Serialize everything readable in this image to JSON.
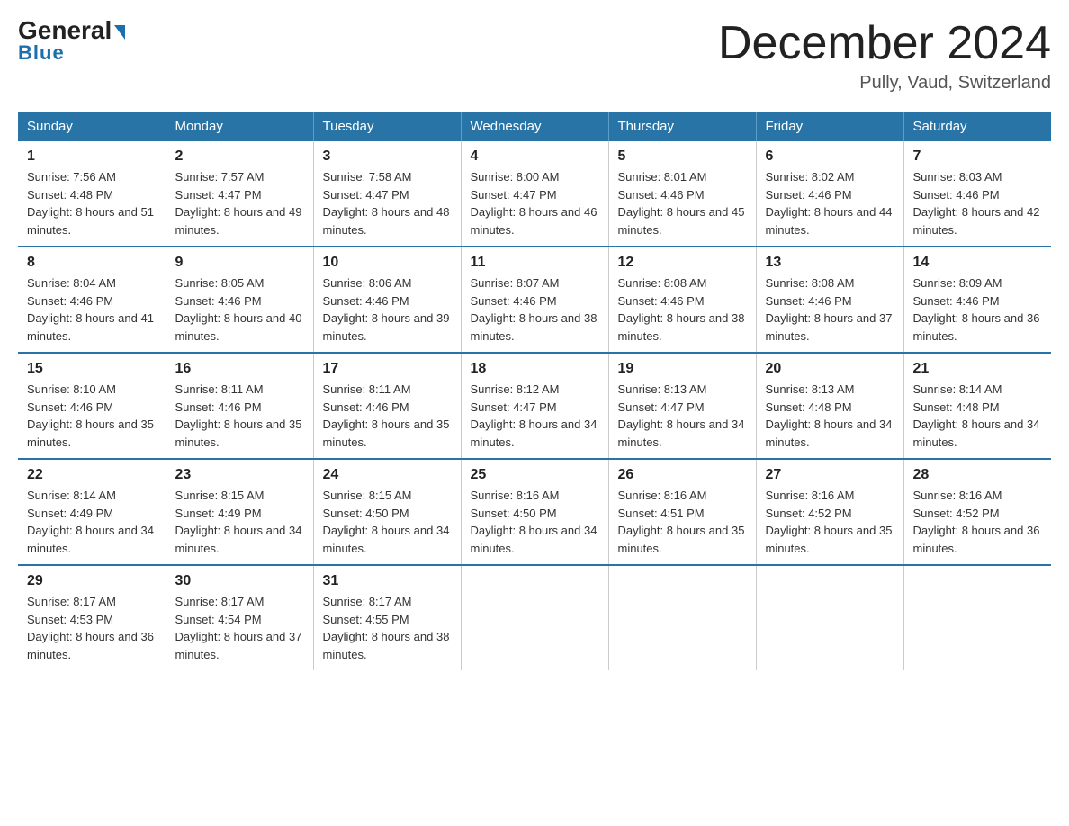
{
  "header": {
    "logo_line1": "General",
    "logo_line2": "Blue",
    "month_title": "December 2024",
    "location": "Pully, Vaud, Switzerland"
  },
  "days_of_week": [
    "Sunday",
    "Monday",
    "Tuesday",
    "Wednesday",
    "Thursday",
    "Friday",
    "Saturday"
  ],
  "weeks": [
    [
      {
        "num": "1",
        "sunrise": "7:56 AM",
        "sunset": "4:48 PM",
        "daylight": "8 hours and 51 minutes."
      },
      {
        "num": "2",
        "sunrise": "7:57 AM",
        "sunset": "4:47 PM",
        "daylight": "8 hours and 49 minutes."
      },
      {
        "num": "3",
        "sunrise": "7:58 AM",
        "sunset": "4:47 PM",
        "daylight": "8 hours and 48 minutes."
      },
      {
        "num": "4",
        "sunrise": "8:00 AM",
        "sunset": "4:47 PM",
        "daylight": "8 hours and 46 minutes."
      },
      {
        "num": "5",
        "sunrise": "8:01 AM",
        "sunset": "4:46 PM",
        "daylight": "8 hours and 45 minutes."
      },
      {
        "num": "6",
        "sunrise": "8:02 AM",
        "sunset": "4:46 PM",
        "daylight": "8 hours and 44 minutes."
      },
      {
        "num": "7",
        "sunrise": "8:03 AM",
        "sunset": "4:46 PM",
        "daylight": "8 hours and 42 minutes."
      }
    ],
    [
      {
        "num": "8",
        "sunrise": "8:04 AM",
        "sunset": "4:46 PM",
        "daylight": "8 hours and 41 minutes."
      },
      {
        "num": "9",
        "sunrise": "8:05 AM",
        "sunset": "4:46 PM",
        "daylight": "8 hours and 40 minutes."
      },
      {
        "num": "10",
        "sunrise": "8:06 AM",
        "sunset": "4:46 PM",
        "daylight": "8 hours and 39 minutes."
      },
      {
        "num": "11",
        "sunrise": "8:07 AM",
        "sunset": "4:46 PM",
        "daylight": "8 hours and 38 minutes."
      },
      {
        "num": "12",
        "sunrise": "8:08 AM",
        "sunset": "4:46 PM",
        "daylight": "8 hours and 38 minutes."
      },
      {
        "num": "13",
        "sunrise": "8:08 AM",
        "sunset": "4:46 PM",
        "daylight": "8 hours and 37 minutes."
      },
      {
        "num": "14",
        "sunrise": "8:09 AM",
        "sunset": "4:46 PM",
        "daylight": "8 hours and 36 minutes."
      }
    ],
    [
      {
        "num": "15",
        "sunrise": "8:10 AM",
        "sunset": "4:46 PM",
        "daylight": "8 hours and 35 minutes."
      },
      {
        "num": "16",
        "sunrise": "8:11 AM",
        "sunset": "4:46 PM",
        "daylight": "8 hours and 35 minutes."
      },
      {
        "num": "17",
        "sunrise": "8:11 AM",
        "sunset": "4:46 PM",
        "daylight": "8 hours and 35 minutes."
      },
      {
        "num": "18",
        "sunrise": "8:12 AM",
        "sunset": "4:47 PM",
        "daylight": "8 hours and 34 minutes."
      },
      {
        "num": "19",
        "sunrise": "8:13 AM",
        "sunset": "4:47 PM",
        "daylight": "8 hours and 34 minutes."
      },
      {
        "num": "20",
        "sunrise": "8:13 AM",
        "sunset": "4:48 PM",
        "daylight": "8 hours and 34 minutes."
      },
      {
        "num": "21",
        "sunrise": "8:14 AM",
        "sunset": "4:48 PM",
        "daylight": "8 hours and 34 minutes."
      }
    ],
    [
      {
        "num": "22",
        "sunrise": "8:14 AM",
        "sunset": "4:49 PM",
        "daylight": "8 hours and 34 minutes."
      },
      {
        "num": "23",
        "sunrise": "8:15 AM",
        "sunset": "4:49 PM",
        "daylight": "8 hours and 34 minutes."
      },
      {
        "num": "24",
        "sunrise": "8:15 AM",
        "sunset": "4:50 PM",
        "daylight": "8 hours and 34 minutes."
      },
      {
        "num": "25",
        "sunrise": "8:16 AM",
        "sunset": "4:50 PM",
        "daylight": "8 hours and 34 minutes."
      },
      {
        "num": "26",
        "sunrise": "8:16 AM",
        "sunset": "4:51 PM",
        "daylight": "8 hours and 35 minutes."
      },
      {
        "num": "27",
        "sunrise": "8:16 AM",
        "sunset": "4:52 PM",
        "daylight": "8 hours and 35 minutes."
      },
      {
        "num": "28",
        "sunrise": "8:16 AM",
        "sunset": "4:52 PM",
        "daylight": "8 hours and 36 minutes."
      }
    ],
    [
      {
        "num": "29",
        "sunrise": "8:17 AM",
        "sunset": "4:53 PM",
        "daylight": "8 hours and 36 minutes."
      },
      {
        "num": "30",
        "sunrise": "8:17 AM",
        "sunset": "4:54 PM",
        "daylight": "8 hours and 37 minutes."
      },
      {
        "num": "31",
        "sunrise": "8:17 AM",
        "sunset": "4:55 PM",
        "daylight": "8 hours and 38 minutes."
      },
      null,
      null,
      null,
      null
    ]
  ]
}
